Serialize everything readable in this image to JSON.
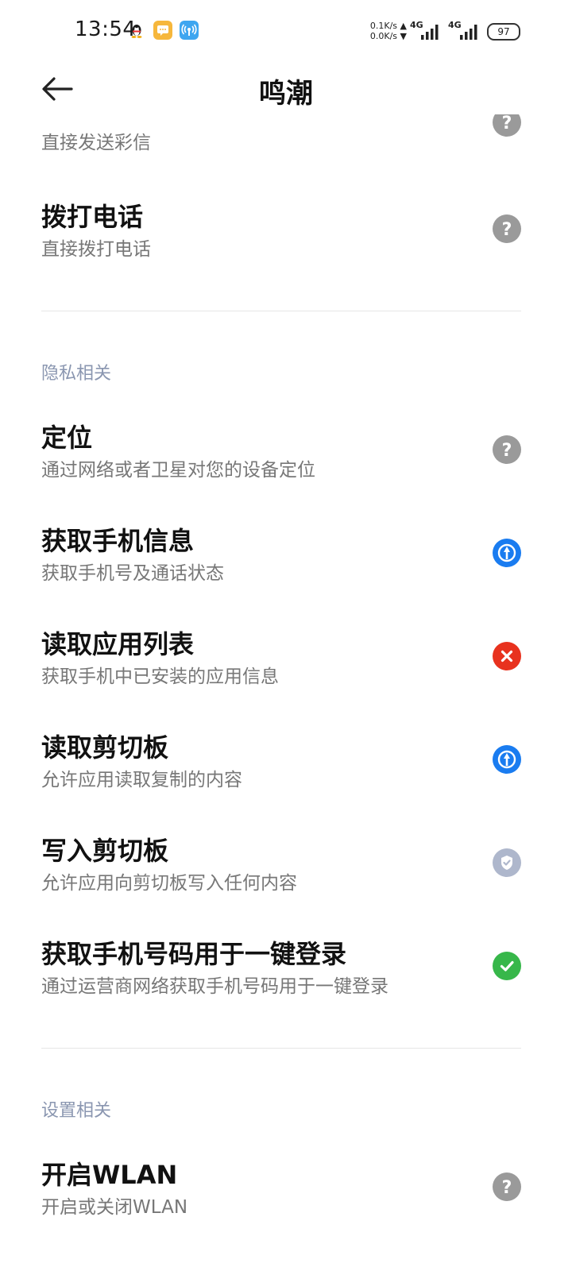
{
  "status_bar": {
    "time": "13:54",
    "speed_up": "0.1K/s ▲",
    "speed_down": "0.0K/s ▼",
    "network_1": "4G",
    "network_2": "4G",
    "battery": "97",
    "icons": [
      "qq-penguin-icon",
      "chat-bubble-icon",
      "broadcast-signal-icon"
    ]
  },
  "header": {
    "title": "鸣潮",
    "back_icon": "arrow-left-icon"
  },
  "partial_item": {
    "desc": "直接发送彩信",
    "status": "unknown"
  },
  "items_group1": [
    {
      "title": "拨打电话",
      "desc": "直接拨打电话",
      "status": "unknown"
    }
  ],
  "section_privacy": {
    "label": "隐私相关",
    "items": [
      {
        "title": "定位",
        "desc": "通过网络或者卫星对您的设备定位",
        "status": "unknown"
      },
      {
        "title": "获取手机信息",
        "desc": "获取手机号及通话状态",
        "status": "ask"
      },
      {
        "title": "读取应用列表",
        "desc": "获取手机中已安装的应用信息",
        "status": "denied"
      },
      {
        "title": "读取剪切板",
        "desc": "允许应用读取复制的内容",
        "status": "ask"
      },
      {
        "title": "写入剪切板",
        "desc": "允许应用向剪切板写入任何内容",
        "status": "default-allowed"
      },
      {
        "title": "获取手机号码用于一键登录",
        "desc": "通过运营商网络获取手机号码用于一键登录",
        "status": "allowed"
      }
    ]
  },
  "section_settings": {
    "label": "设置相关",
    "items": [
      {
        "title": "开启WLAN",
        "desc": "开启或关闭WLAN",
        "status": "unknown"
      }
    ]
  },
  "colors": {
    "unknown": "#9a9a9a",
    "ask": "#1a7cf0",
    "denied": "#e8321e",
    "default-allowed": "#aeb7cc",
    "allowed": "#37b74a",
    "section_label": "#8a96b0",
    "desc_text": "#777777"
  }
}
